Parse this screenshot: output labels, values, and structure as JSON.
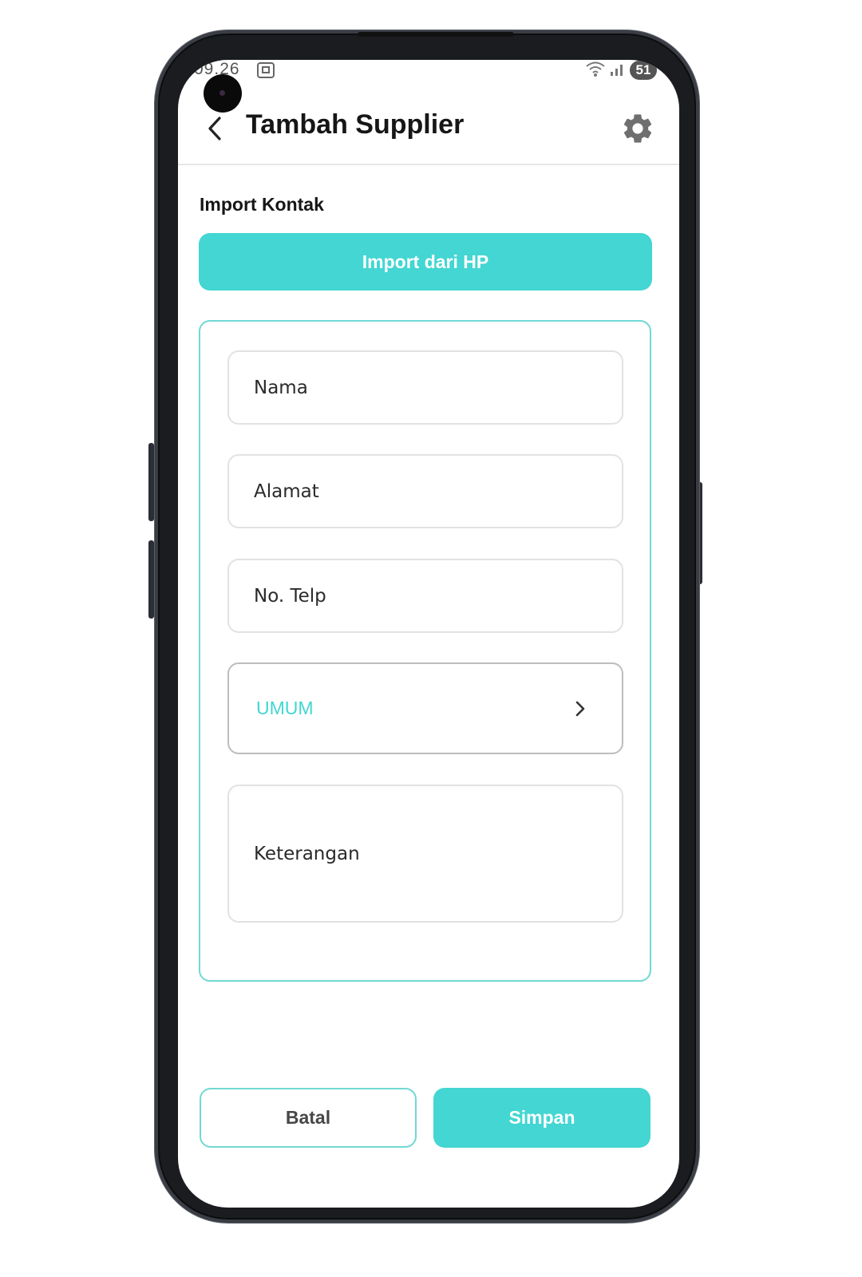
{
  "status_bar": {
    "time": "09.26",
    "battery": "51"
  },
  "header": {
    "title": "Tambah Supplier",
    "back_icon": "chevron-left-icon",
    "settings_icon": "gear-icon"
  },
  "import_section": {
    "label": "Import Kontak",
    "button_label": "Import dari HP"
  },
  "form": {
    "nama_placeholder": "Nama",
    "alamat_placeholder": "Alamat",
    "telp_placeholder": "No. Telp",
    "kategori_value": "UMUM",
    "keterangan_placeholder": "Keterangan"
  },
  "actions": {
    "cancel_label": "Batal",
    "save_label": "Simpan"
  },
  "colors": {
    "accent": "#43d6d2",
    "accent_border": "#71d8d4",
    "title_text": "#161616",
    "body_text": "#2a2a2a"
  }
}
